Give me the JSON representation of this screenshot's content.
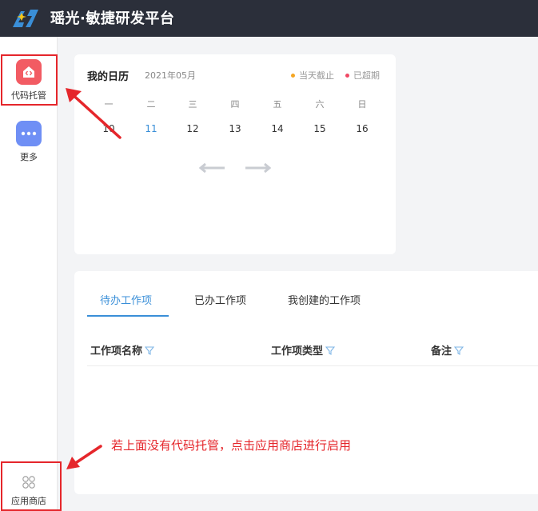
{
  "app": {
    "title": "瑶光·敏捷研发平台"
  },
  "sidebar": {
    "items": [
      {
        "label": "代码托管"
      },
      {
        "label": "更多"
      }
    ],
    "bottom": {
      "label": "应用商店"
    }
  },
  "calendar": {
    "title": "我的日历",
    "month": "2021年05月",
    "legend": [
      {
        "label": "当天截止",
        "color": "#f5a623"
      },
      {
        "label": "已超期",
        "color": "#f04864"
      }
    ],
    "weekdays": [
      "一",
      "二",
      "三",
      "四",
      "五",
      "六",
      "日"
    ],
    "days": [
      "10",
      "11",
      "12",
      "13",
      "14",
      "15",
      "16"
    ],
    "today_index": 1
  },
  "work": {
    "tabs": [
      {
        "label": "待办工作项"
      },
      {
        "label": "已办工作项"
      },
      {
        "label": "我创建的工作项"
      }
    ],
    "active_tab_index": 0,
    "columns": [
      {
        "label": "工作项名称"
      },
      {
        "label": "工作项类型"
      },
      {
        "label": "备注"
      }
    ]
  },
  "annotation": {
    "note": "若上面没有代码托管，点击应用商店进行启用"
  },
  "colors": {
    "accent": "#3a8fd8",
    "highlight": "#e5262b",
    "topbar": "#2b2f3a"
  }
}
